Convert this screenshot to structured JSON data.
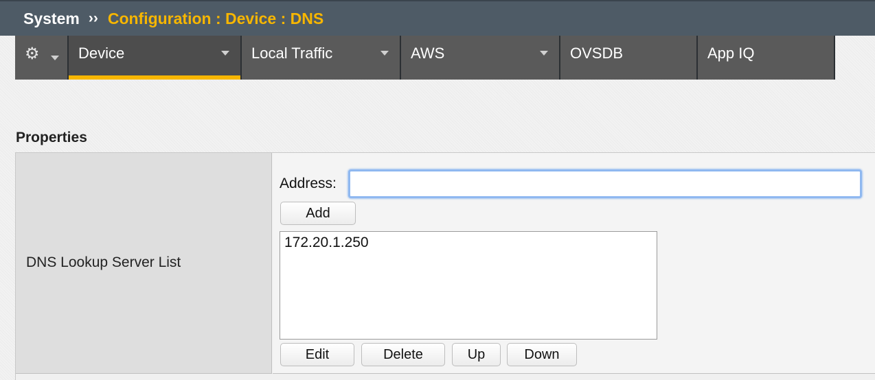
{
  "breadcrumb": {
    "root": "System",
    "separator": "››",
    "path": "Configuration : Device : DNS"
  },
  "tabs": [
    {
      "label": "",
      "icon": "gear-icon",
      "has_dropdown": true
    },
    {
      "label": "Device",
      "active": true,
      "has_dropdown": true
    },
    {
      "label": "Local Traffic",
      "has_dropdown": true
    },
    {
      "label": "AWS",
      "has_dropdown": true
    },
    {
      "label": "OVSDB",
      "has_dropdown": false
    },
    {
      "label": "App IQ",
      "has_dropdown": false
    }
  ],
  "section": {
    "title": "Properties"
  },
  "dns_lookup": {
    "row_label": "DNS Lookup Server List",
    "address_label": "Address:",
    "address_value": "",
    "add_button": "Add",
    "servers": [
      "172.20.1.250"
    ],
    "edit_button": "Edit",
    "delete_button": "Delete",
    "up_button": "Up",
    "down_button": "Down"
  },
  "colors": {
    "accent": "#f7b600",
    "titlebar_bg": "#4e5b66",
    "tab_bg": "#5a5a5a",
    "focus_ring": "#8fb8f0"
  }
}
